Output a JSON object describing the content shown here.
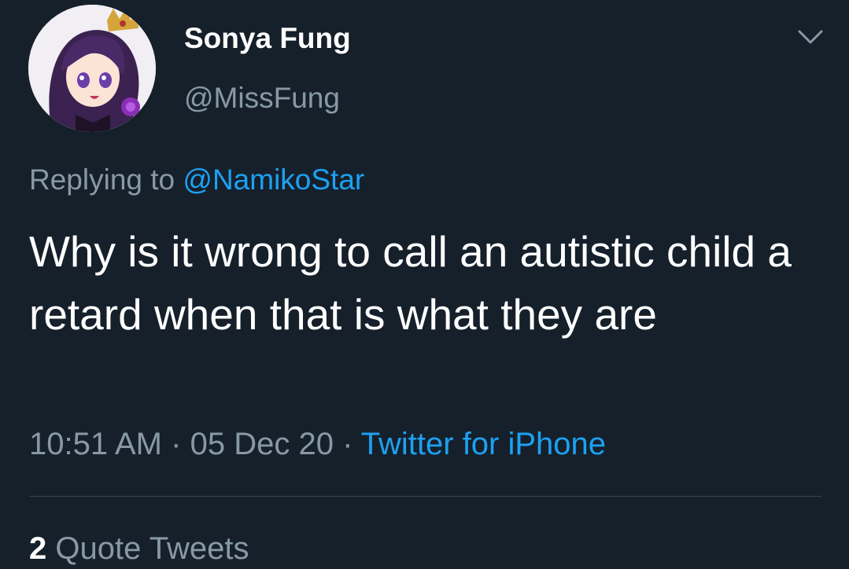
{
  "tweet": {
    "author": {
      "display_name": "Sonya Fung",
      "handle": "@MissFung"
    },
    "reply": {
      "prefix": "Replying to",
      "target": "@NamikoStar"
    },
    "text": "Why is it wrong to call an autistic child a retard when that is what they are",
    "meta": {
      "time": "10:51 AM",
      "separator": "·",
      "date": "05 Dec 20",
      "source": "Twitter for iPhone"
    },
    "stats": {
      "quote_count": "2",
      "quote_label": "Quote Tweets"
    }
  },
  "icons": {
    "menu": "chevron-down-icon"
  },
  "colors": {
    "background": "#15202b",
    "text_primary": "#ffffff",
    "text_secondary": "#8899a6",
    "link": "#1da1f2",
    "divider": "#38444d"
  }
}
